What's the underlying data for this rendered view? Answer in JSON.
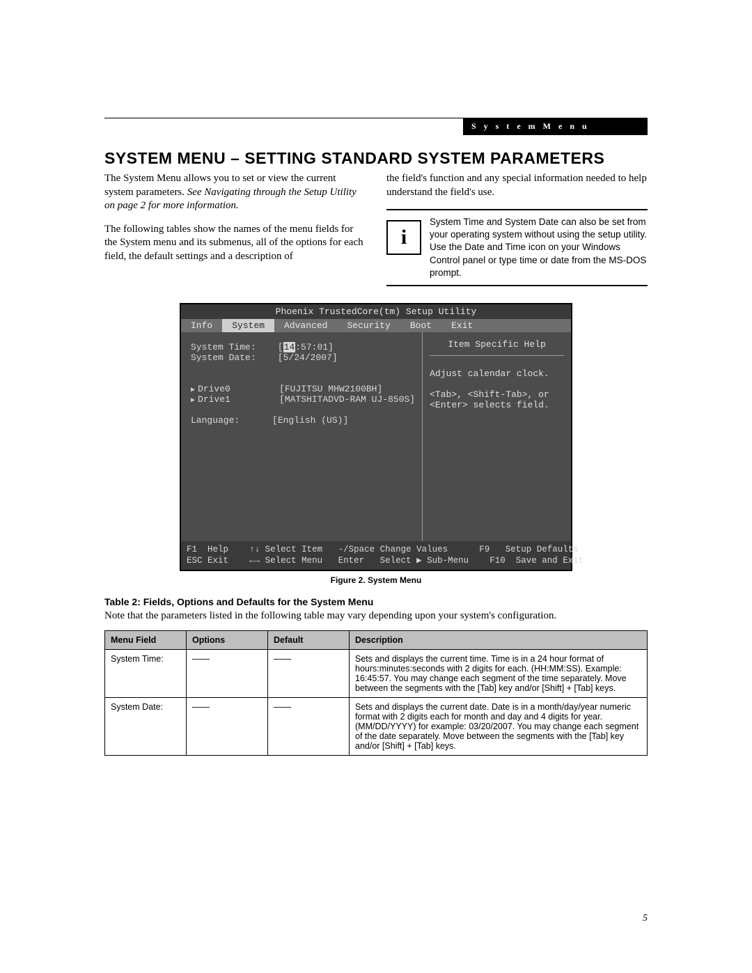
{
  "header": {
    "tab_label": "S y s t e m   M e n u"
  },
  "title": "SYSTEM MENU – SETTING STANDARD SYSTEM PARAMETERS",
  "intro": {
    "left_p1a": "The System Menu allows you to set or view the current system parameters. ",
    "left_p1b_italic": "See Navigating through the Setup Utility on page 2 for more information.",
    "left_p2": "The following tables show the names of the menu fields for the System menu and its submenus, all of the options for each field, the default settings and a description of",
    "right_p1": "the field's function and any special information needed to help understand the field's use.",
    "note_icon": "i",
    "note_text": "System Time and System Date can also be set from your operating system without using the setup utility. Use the Date and Time icon on your Windows Control panel or type time or date from the MS-DOS prompt."
  },
  "bios": {
    "utility_title": "Phoenix TrustedCore(tm) Setup Utility",
    "tabs": [
      "Info",
      "System",
      "Advanced",
      "Security",
      "Boot",
      "Exit"
    ],
    "selected_tab_index": 1,
    "fields": {
      "system_time_label": "System Time:",
      "system_time_value": "[14:57:01]",
      "system_time_cursor": "14",
      "system_time_rest": ":57:01]",
      "system_date_label": "System Date:",
      "system_date_value": "[5/24/2007]",
      "drive0_label": "Drive0",
      "drive0_value": "[FUJITSU MHW2100BH]",
      "drive1_label": "Drive1",
      "drive1_value": "[MATSHITADVD-RAM UJ-850S]",
      "language_label": "Language:",
      "language_value": "[English (US)]"
    },
    "help": {
      "header": "Item Specific Help",
      "line1": "Adjust calendar clock.",
      "line2": "<Tab>, <Shift-Tab>, or",
      "line3": "<Enter> selects field."
    },
    "footer": {
      "f1": "F1",
      "help": "Help",
      "updown": "↑↓ Select Item",
      "minus_space": "-/Space",
      "change_values": "Change Values",
      "f9": "F9",
      "setup_defaults": "Setup Defaults",
      "esc": "ESC",
      "exit": "Exit",
      "leftright": "←→ Select Menu",
      "enter": "Enter",
      "select_sub": "Select ▶ Sub-Menu",
      "f10": "F10",
      "save_exit": "Save and Exit"
    }
  },
  "figure_caption": "Figure 2.   System Menu",
  "table_caption": "Table 2: Fields, Options and Defaults for the System Menu",
  "table_note": "Note that the parameters listed in the following table may vary depending upon your system's configuration.",
  "table": {
    "headers": [
      "Menu Field",
      "Options",
      "Default",
      "Description"
    ],
    "rows": [
      {
        "menu_field": "System Time:",
        "options": "——",
        "default_": "——",
        "description": "Sets and displays the current time. Time is in a 24 hour format of hours:minutes:seconds with 2 digits for each. (HH:MM:SS). Example: 16:45:57. You may change each segment of the time separately. Move between the segments with the [Tab] key and/or [Shift] + [Tab] keys."
      },
      {
        "menu_field": "System Date:",
        "options": "——",
        "default_": "——",
        "description": "Sets and displays the current date. Date is in a month/day/year numeric format with 2 digits each for month and day and 4 digits for year. (MM/DD/YYYY) for example: 03/20/2007. You may change each segment of the date separately. Move between the segments with the [Tab] key and/or [Shift] + [Tab] keys."
      }
    ]
  },
  "page_number": "5"
}
